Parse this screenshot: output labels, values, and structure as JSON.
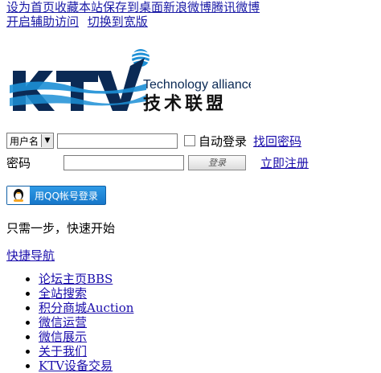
{
  "top_links": {
    "set_home": "设为首页",
    "bookmark": "收藏本站",
    "save_desktop": "保存到桌面",
    "sina_weibo": "新浪微博",
    "tencent_weibo": "腾讯微博",
    "accessibility": "开启辅助访问",
    "wide_mode": "切换到宽版"
  },
  "logo": {
    "brand": "KTV",
    "subtitle_en": "Technology alliance",
    "subtitle_cn": "技术联盟",
    "colors": {
      "blue": "#1c8fd6",
      "dark": "#0b2a55"
    }
  },
  "login": {
    "username_select": "用户名",
    "auto_login": "自动登录",
    "find_password": "找回密码",
    "password_label": "密码",
    "login_button": "登录",
    "register": "立即注册",
    "qq_login": "用QQ帐号登录"
  },
  "tagline": "只需一步，快速开始",
  "quick_nav": "快捷导航",
  "nav_items": [
    "论坛主页BBS",
    "全站搜索",
    "积分商城Auction",
    "微信运营",
    "微信展示",
    "关于我们",
    "KTV设备交易"
  ]
}
